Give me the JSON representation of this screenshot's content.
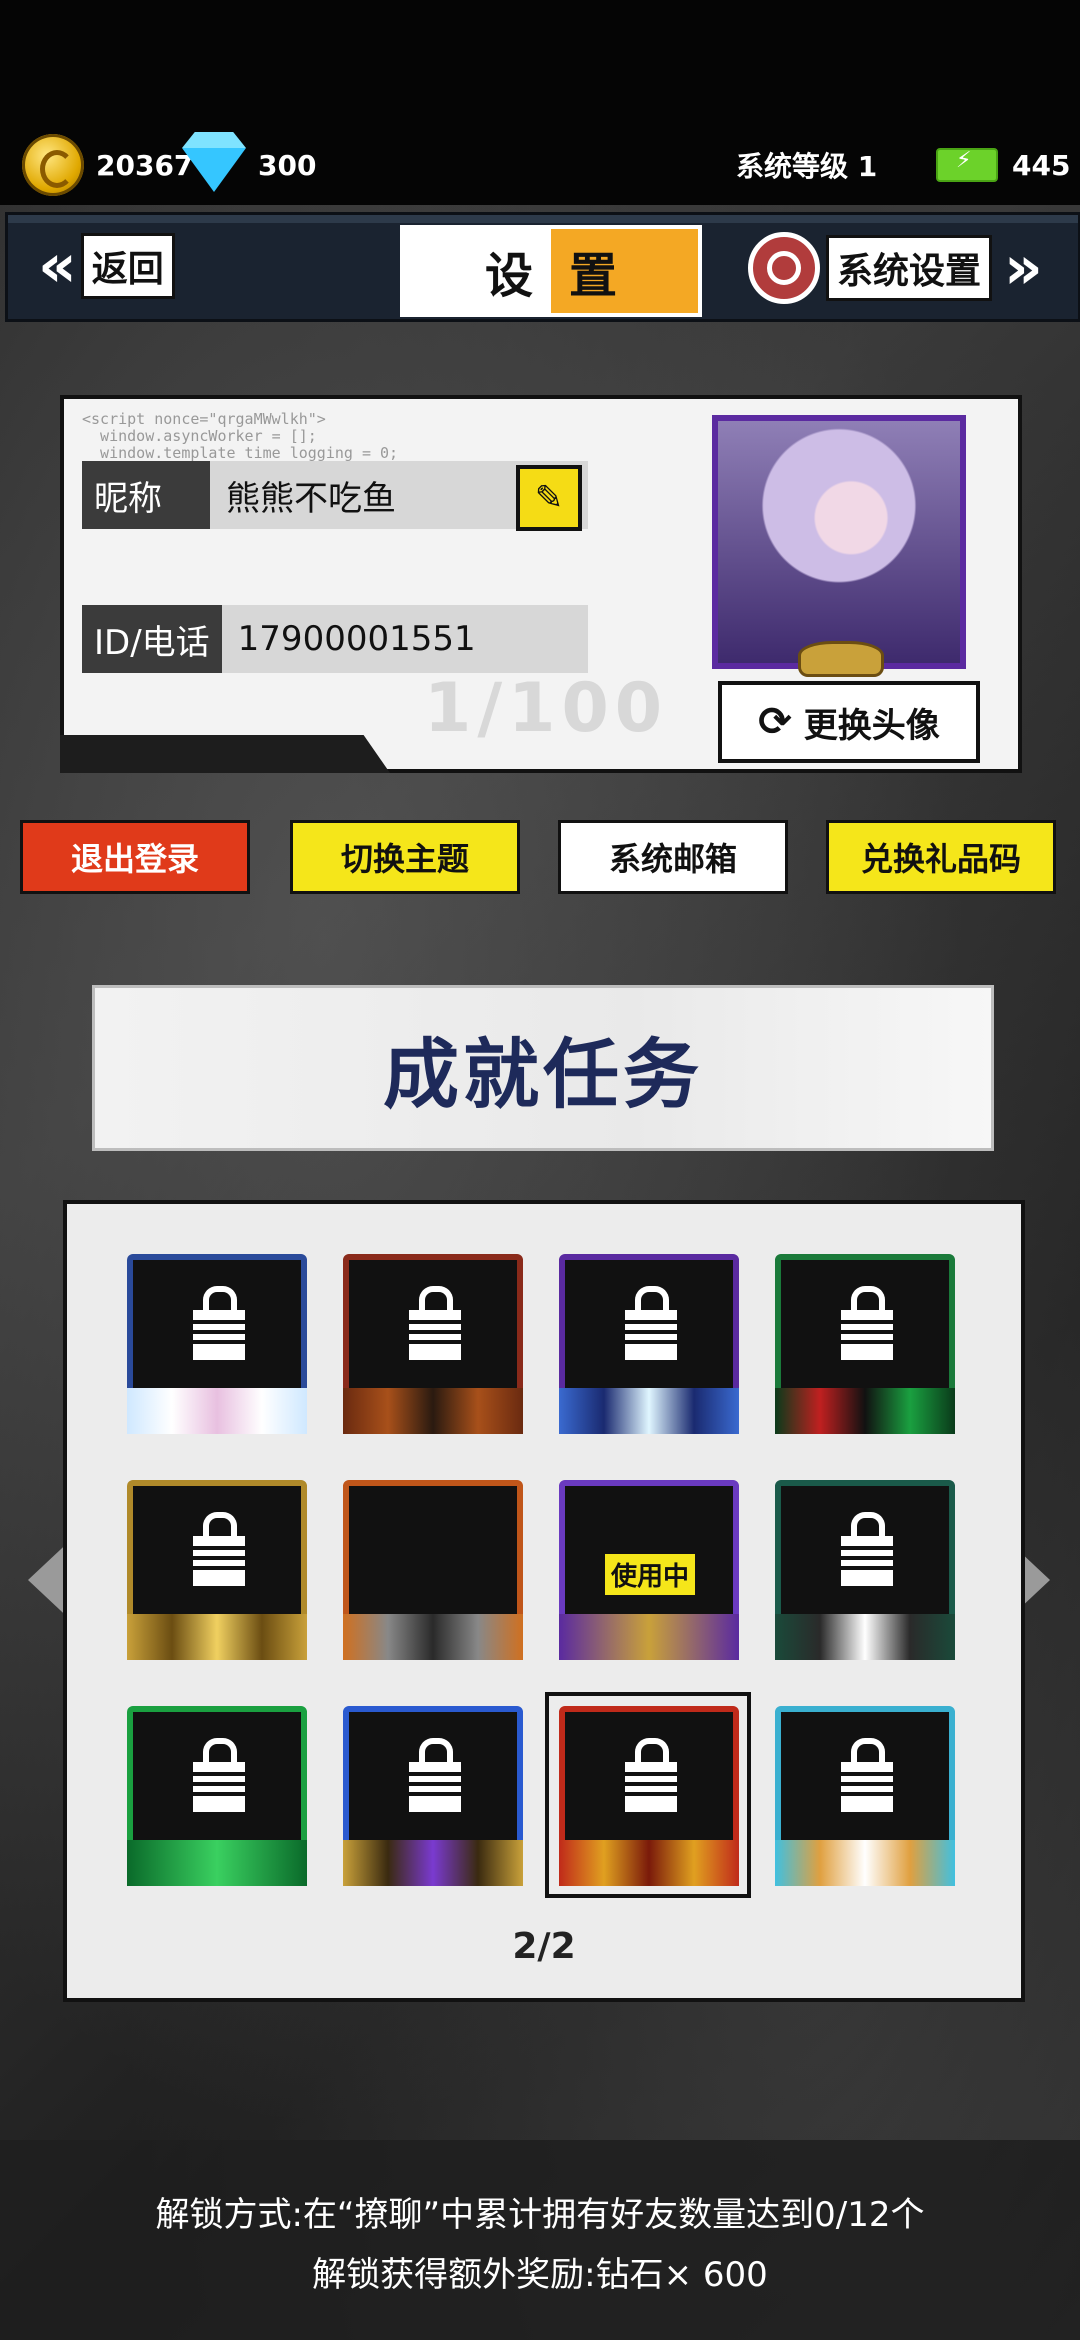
{
  "resources": {
    "coins": "20367",
    "diamonds": "300",
    "system_level": "系统等级 1",
    "energy": "445"
  },
  "header": {
    "back_label": "返回",
    "title_left": "设",
    "title_right": "置",
    "system_settings_label": "系统设置"
  },
  "profile": {
    "nickname_label": "昵称",
    "nickname_value": "熊熊不吃鱼",
    "id_label": "ID/电话",
    "id_value": "17900001551",
    "change_avatar_label": "更换头像",
    "decor_code": "<script nonce=\"qrgaMWwlkh\">\n  window.asyncWorker = [];\n  window.template_time_logging = 0;\n\n  streamHeaderComponent.style = \n  streamHeaderComponent.style.display = \"none\";",
    "faint_text": "1/100"
  },
  "actions": {
    "logout": "退出登录",
    "switch_theme": "切换主题",
    "system_mail": "系统邮箱",
    "redeem_code": "兑换礼品码"
  },
  "achievement": {
    "title": "成就任务",
    "in_use_label": "使用中",
    "page": "2/2"
  },
  "unlock": {
    "method": "解锁方式:在“撩聊”中累计拥有好友数量达到0/12个",
    "reward": "解锁获得额外奖励:钻石× 600"
  },
  "colors": {
    "accent_orange": "#f4a824",
    "accent_yellow": "#f5e61a",
    "logout_red": "#e03a1a",
    "title_navy": "#1e2a5a"
  }
}
